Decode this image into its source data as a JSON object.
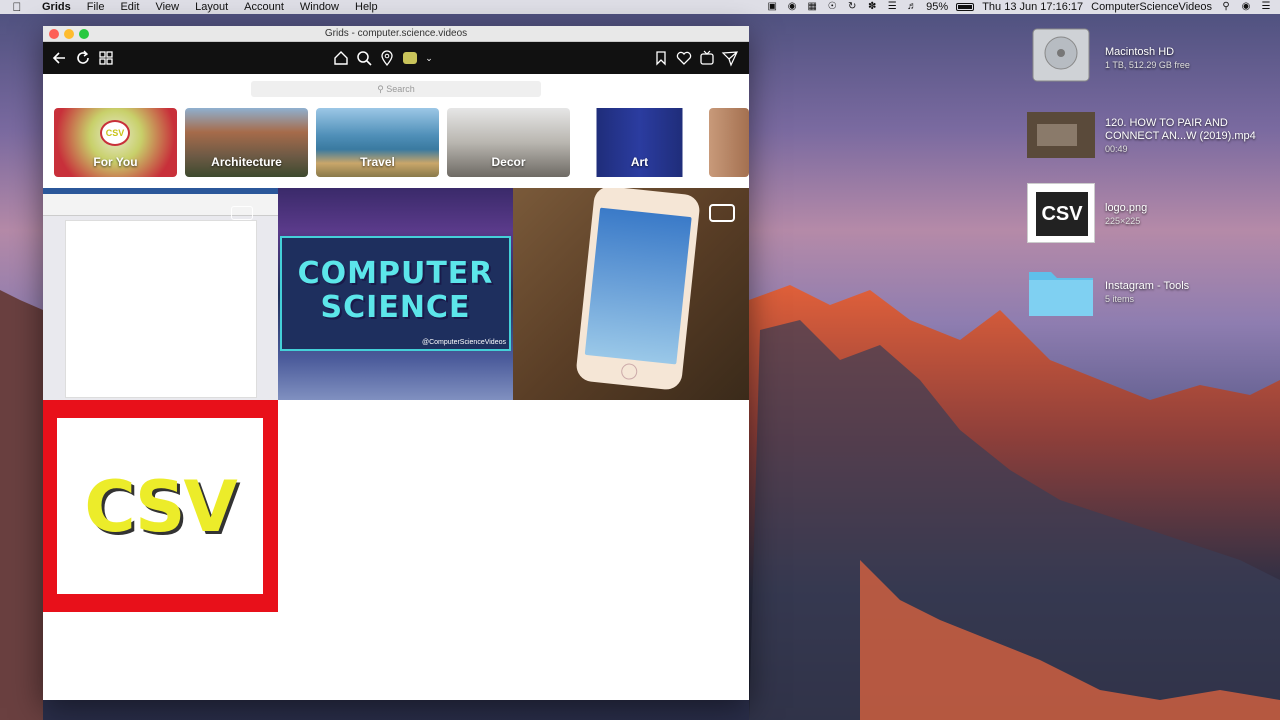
{
  "menubar": {
    "app_name": "Grids",
    "items": [
      "File",
      "Edit",
      "View",
      "Layout",
      "Account",
      "Window",
      "Help"
    ],
    "battery": "95%",
    "clock": "Thu 13 Jun  17:16:17",
    "user": "ComputerScienceVideos"
  },
  "window": {
    "title": "Grids - computer.science.videos",
    "search_placeholder": "Search"
  },
  "categories": [
    {
      "label": "For You",
      "color": "#c8303a",
      "badge": "CSV"
    },
    {
      "label": "Architecture",
      "color": "#6d5a45"
    },
    {
      "label": "Travel",
      "color": "#4f8fb8"
    },
    {
      "label": "Decor",
      "color": "#b9b6b0"
    },
    {
      "label": "Art",
      "color": "#1f2d7a"
    }
  ],
  "posts": {
    "post2": {
      "line1": "COMPUTER",
      "line2": "SCIENCE",
      "handle": "@ComputerScienceVideos"
    },
    "post4": {
      "text": "CSV"
    }
  },
  "desktop": {
    "items": [
      {
        "name": "Macintosh HD",
        "sub": "1 TB, 512.29 GB free"
      },
      {
        "name": "120. HOW TO PAIR AND CONNECT AN...W (2019).mp4",
        "sub": "00:49"
      },
      {
        "name": "logo.png",
        "sub": "225×225",
        "badge": "CSV"
      },
      {
        "name": "Instagram - Tools",
        "sub": "5 items"
      }
    ]
  }
}
